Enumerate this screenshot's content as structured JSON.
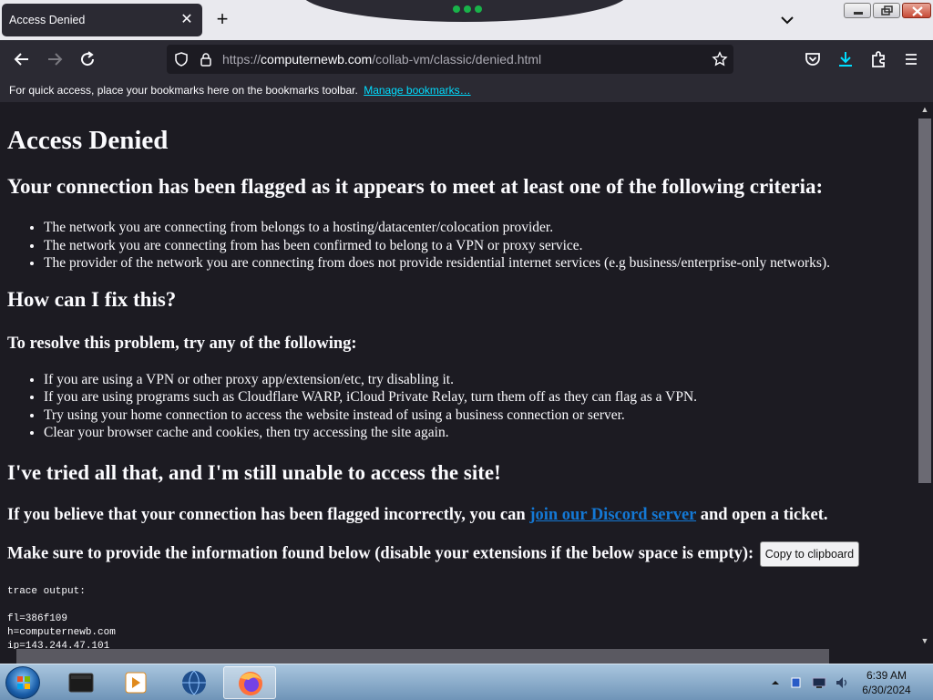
{
  "browser": {
    "tab": {
      "title": "Access Denied"
    },
    "url": {
      "host": "computernewb.com",
      "protocol": "https://",
      "path": "/collab-vm/classic/denied.html"
    },
    "bookmarks_bar": {
      "message": "For quick access, place your bookmarks here on the bookmarks toolbar.",
      "link": "Manage bookmarks…"
    }
  },
  "page": {
    "title": "Access Denied",
    "criteria_heading": "Your connection has been flagged as it appears to meet at least one of the following criteria:",
    "criteria": [
      "The network you are connecting from belongs to a hosting/datacenter/colocation provider.",
      "The network you are connecting from has been confirmed to belong to a VPN or proxy service.",
      "The provider of the network you are connecting from does not provide residential internet services (e.g business/enterprise-only networks)."
    ],
    "fix_heading": "How can I fix this?",
    "resolve_heading": "To resolve this problem, try any of the following:",
    "fixes": [
      "If you are using a VPN or other proxy app/extension/etc, try disabling it.",
      "If you are using programs such as Cloudflare WARP, iCloud Private Relay, turn them off as they can flag as a VPN.",
      "Try using your home connection to access the website instead of using a business connection or server.",
      "Clear your browser cache and cookies, then try accessing the site again."
    ],
    "tried_heading": "I've tried all that, and I'm still unable to access the site!",
    "contact": {
      "before": "If you believe that your connection has been flagged incorrectly, you can ",
      "link": "join our Discord server",
      "after": " and open a ticket."
    },
    "provide_text": "Make sure to provide the information found below (disable your extensions if the below space is empty):",
    "copy_button": "Copy to clipboard",
    "trace": {
      "label": "trace output:",
      "lines": [
        "fl=386f109",
        "h=computernewb.com",
        "ip=143.244.47.101"
      ]
    }
  },
  "taskbar": {
    "time": "6:39 AM",
    "date": "6/30/2024"
  }
}
